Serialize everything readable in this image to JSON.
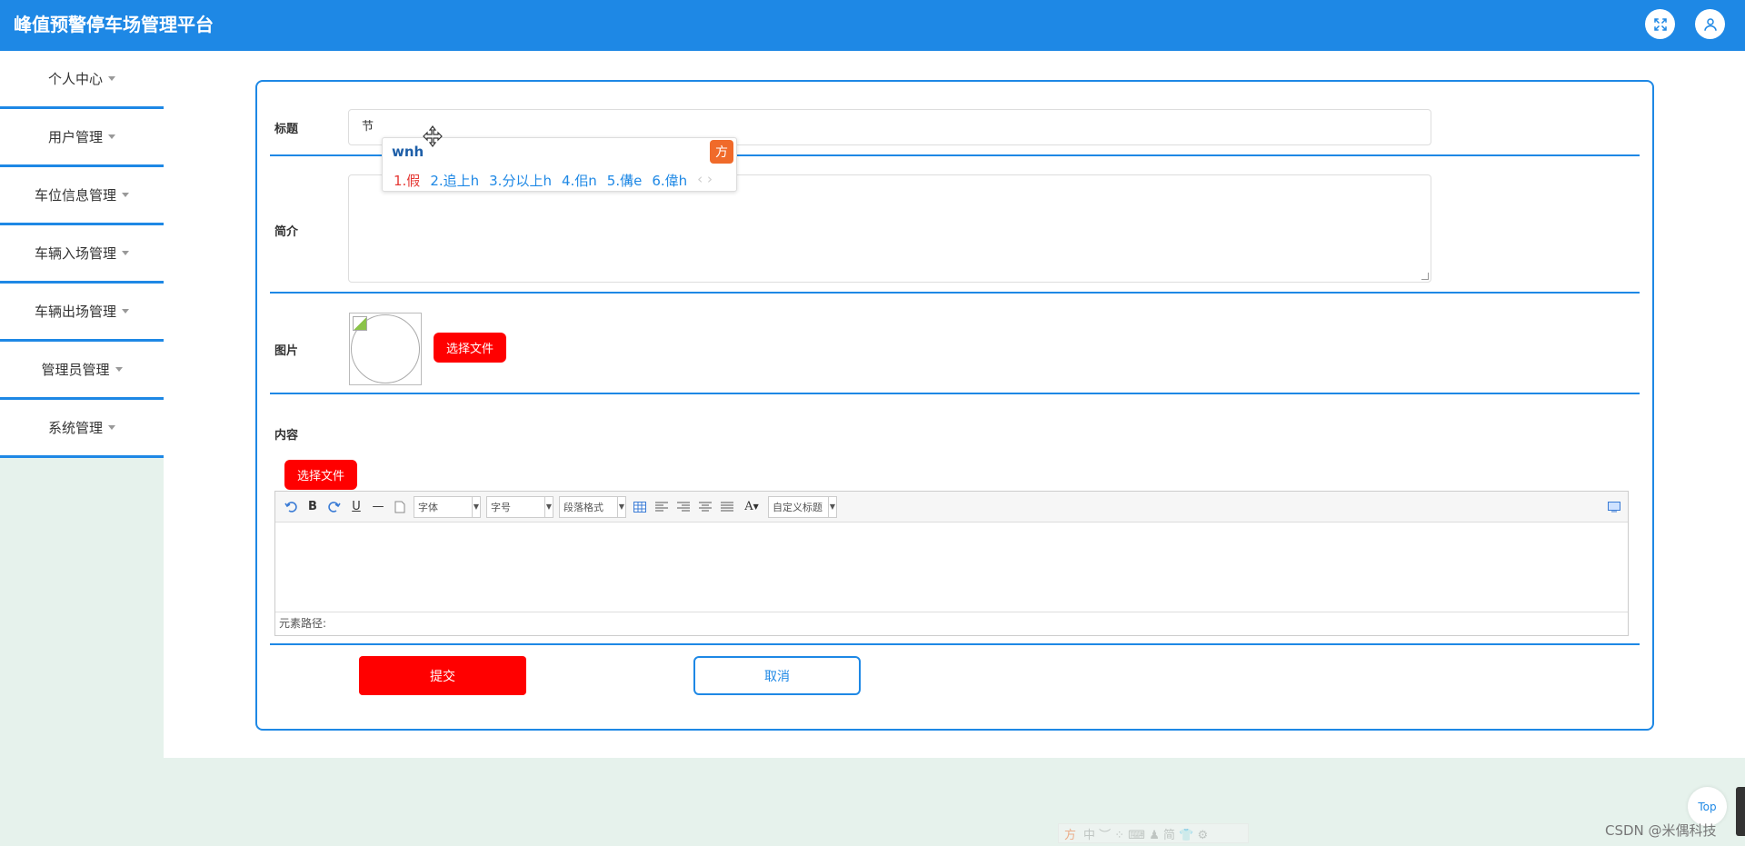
{
  "header": {
    "title": "峰值预警停车场管理平台"
  },
  "sidebar": {
    "items": [
      {
        "label": "个人中心"
      },
      {
        "label": "用户管理"
      },
      {
        "label": "车位信息管理"
      },
      {
        "label": "车辆入场管理"
      },
      {
        "label": "车辆出场管理"
      },
      {
        "label": "管理员管理"
      },
      {
        "label": "系统管理"
      }
    ]
  },
  "form": {
    "title_label": "标题",
    "title_value": "节",
    "intro_label": "简介",
    "image_label": "图片",
    "choose_file": "选择文件",
    "content_label": "内容",
    "content_choose_file": "选择文件",
    "submit": "提交",
    "cancel": "取消"
  },
  "editor": {
    "font_family": "字体",
    "font_size": "字号",
    "paragraph": "段落格式",
    "custom_title": "自定义标题",
    "status_path": "元素路径:"
  },
  "ime": {
    "composition": "wnh",
    "candidates": [
      "1.假",
      "2.追上h",
      "3.分以上h",
      "4.佀n",
      "5.傋e",
      "6.偉h"
    ]
  },
  "misc": {
    "top_button": "Top",
    "watermark": "CSDN @米偶科技",
    "ime_bar_glyphs": "中 ︶ ⁘ ⌨ ♟ 简 👕 ⚙"
  },
  "colors": {
    "primary": "#1e88e5",
    "danger": "#ff0000",
    "background": "#e6f2ec"
  }
}
